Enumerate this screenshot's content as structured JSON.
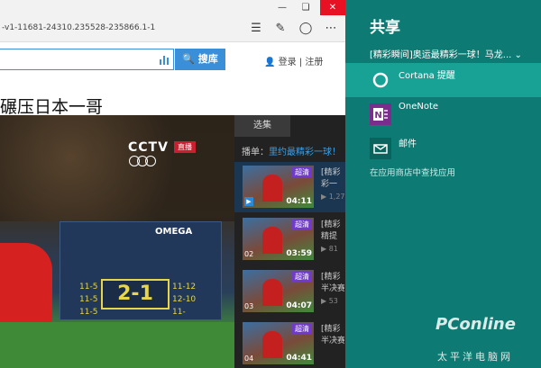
{
  "browser": {
    "url": "-v1-11681-24310.235528-235866.1-1",
    "search_button": "搜库",
    "login_link": "登录",
    "register_link": "注册",
    "page_title": "碾压日本一哥"
  },
  "video": {
    "channel_logo": "CCTV",
    "live_badge": "直播",
    "sponsor": "OMEGA",
    "set_score": "2-1",
    "left_scores": [
      "11-5",
      "11-5",
      "11-5"
    ],
    "right_scores": [
      "11-12",
      "12-10",
      "11-"
    ]
  },
  "playlist": {
    "tab_label": "选集",
    "heading_prefix": "播单：",
    "heading_link": "里约最精彩一球！",
    "items": [
      {
        "badge": "超清",
        "num": "",
        "duration": "04:11",
        "text": "[精彩",
        "text2": "彩一",
        "meta": "1,27",
        "active": true
      },
      {
        "badge": "超清",
        "num": "02",
        "duration": "03:59",
        "text": "[精彩",
        "text2": "精提",
        "meta": "81",
        "active": false
      },
      {
        "badge": "超清",
        "num": "03",
        "duration": "04:07",
        "text": "[精彩",
        "text2": "半决赛",
        "meta": "53",
        "active": false
      },
      {
        "badge": "超清",
        "num": "04",
        "duration": "04:41",
        "text": "[精彩",
        "text2": "半决赛",
        "meta": "",
        "active": false
      }
    ]
  },
  "share": {
    "title": "共享",
    "subject": "[精彩瞬间]奥运最精彩一球！马龙...",
    "targets": [
      {
        "label": "Cortana 提醒",
        "selected": true
      },
      {
        "label": "OneNote",
        "selected": false
      },
      {
        "label": "邮件",
        "selected": false
      }
    ],
    "store_link": "在应用商店中查找应用"
  },
  "watermark": {
    "brand": "PConline",
    "sub": "太平洋电脑网"
  },
  "colors": {
    "share_bg": "#0d7b73",
    "share_selected": "#18a195",
    "search_blue": "#3a8fd8",
    "badge_purple": "#6f3bc8"
  }
}
